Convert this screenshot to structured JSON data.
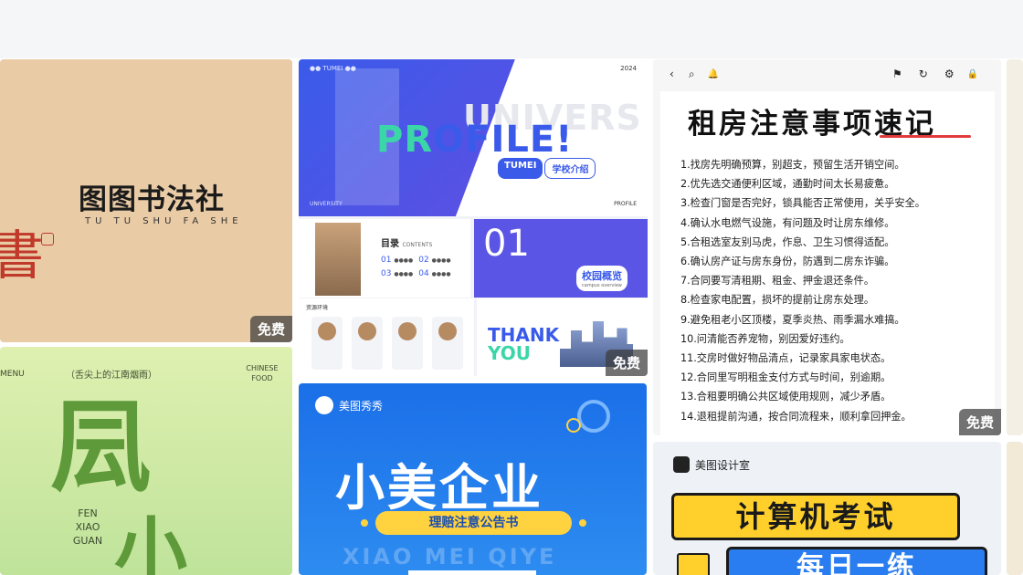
{
  "badges": {
    "free": "免费"
  },
  "card1": {
    "title": "图图书法社",
    "subtitle": "TU TU SHU FA SHE",
    "seal": "書"
  },
  "card2": {
    "menu": "MENU",
    "top": "（舌尖上的江南烟雨）",
    "chinese_food": "CHINESE FOOD",
    "big1": "凨",
    "big2": "小",
    "pinyin": "FEN XIAO GUAN"
  },
  "card3": {
    "header": "●● TUMEI ●●",
    "year": "2024",
    "univ": "UNIVERS",
    "profile_green": "PR",
    "profile_rest": "OFILE!",
    "tag1": "TUMEI",
    "tag2": "学校介绍",
    "university": "UNIVERSITY",
    "profile_small": "PROFILE",
    "menu_title": "目录",
    "menu_sub": "CONTENTS",
    "num": "01",
    "campus": "校园概览",
    "campus_sub": "campus overview",
    "thank": "THANK",
    "you": "YOU",
    "s4_title": "资源环境"
  },
  "card4": {
    "brand": "美图秀秀",
    "headline": "小美企业",
    "pill": "理赔注意公告书",
    "ghost": "XIAO MEI QIYE"
  },
  "card5": {
    "title": "租房注意事项速记",
    "items": [
      "1.找房先明确预算，别超支，预留生活开销空间。",
      "2.优先选交通便利区域，通勤时间太长易疲惫。",
      "3.检查门窗是否完好，锁具能否正常使用，关乎安全。",
      "4.确认水电燃气设施，有问题及时让房东维修。",
      "5.合租选室友别马虎，作息、卫生习惯得适配。",
      "6.确认房产证与房东身份，防遇到二房东诈骗。",
      "7.合同要写清租期、租金、押金退还条件。",
      "8.检查家电配置，损坏的提前让房东处理。",
      "9.避免租老小区顶楼，夏季炎热、雨季漏水难搞。",
      "10.问清能否养宠物，别因爱好违约。",
      "11.交房时做好物品清点，记录家具家电状态。",
      "12.合同里写明租金支付方式与时间，别逾期。",
      "13.合租要明确公共区域使用规则，减少矛盾。",
      "14.退租提前沟通，按合同流程来，顺利拿回押金。"
    ],
    "toolbar": [
      "‹",
      "⌕",
      "🔔",
      "⚑",
      "↻",
      "⚙",
      "🔒"
    ]
  },
  "card6": {
    "brand": "美图设计室",
    "t1": "计算机考试",
    "t2": "每日一练"
  },
  "colors": {
    "accent_blue": "#3a5bea",
    "accent_green": "#3bd6a8",
    "red": "#c0392b",
    "yellow": "#ffd23f"
  }
}
